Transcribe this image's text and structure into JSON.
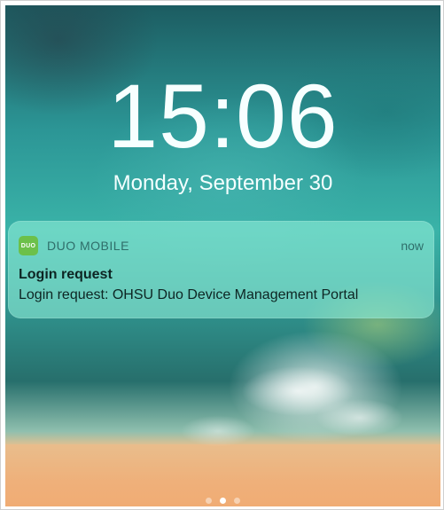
{
  "lockscreen": {
    "time": "15:06",
    "date": "Monday, September 30"
  },
  "notification": {
    "app_icon_text": "DUO",
    "app_name": "DUO MOBILE",
    "when": "now",
    "title": "Login request",
    "body": "Login request: OHSU Duo Device Management Portal",
    "app_icon_color": "#6cc04a"
  },
  "page_indicator": {
    "pages": 3,
    "active_page": 2
  }
}
